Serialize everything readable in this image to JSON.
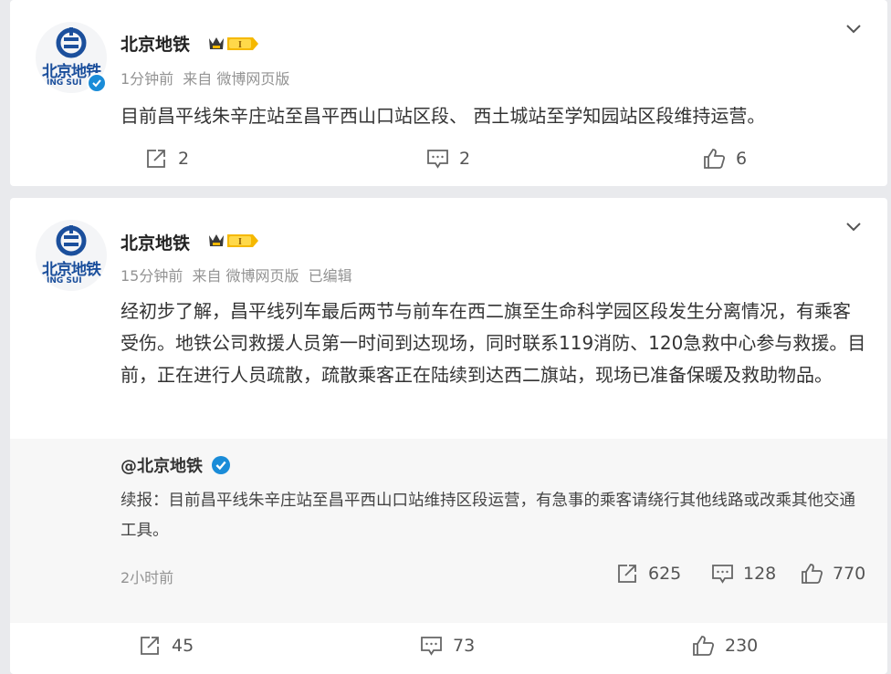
{
  "posts": [
    {
      "user": "北京地铁",
      "avatar_text": "北京地铁",
      "avatar_sub": "ING SUI",
      "time": "1分钟前",
      "source": "来自 微博网页版",
      "edited": "",
      "text": "目前昌平线朱辛庄站至昌平西山口站区段、 西土城站至学知园站区段维持运营。",
      "reposts": "2",
      "comments": "2",
      "likes": "6"
    },
    {
      "user": "北京地铁",
      "avatar_text": "北京地铁",
      "avatar_sub": "ING SUI",
      "time": "15分钟前",
      "source": "来自 微博网页版",
      "edited": "已编辑",
      "text": "经初步了解，昌平线列车最后两节与前车在西二旗至生命科学园区段发生分离情况，有乘客受伤。地铁公司救援人员第一时间到达现场，同时联系119消防、120急救中心参与救援。目前，正在进行人员疏散，疏散乘客正在陆续到达西二旗站，现场已准备保暖及救助物品。",
      "retweet": {
        "user": "@北京地铁",
        "text": "续报：目前昌平线朱辛庄站至昌平西山口站维持区段运营，有急事的乘客请绕行其他线路或改乘其他交通工具。",
        "time": "2小时前",
        "reposts": "625",
        "comments": "128",
        "likes": "770"
      },
      "reposts": "45",
      "comments": "73",
      "likes": "230"
    }
  ],
  "colors": {
    "brand_blue": "#1b4f9c",
    "verified_blue": "#1a8cd8",
    "badge_gold": "#f5b800"
  },
  "icons": [
    "repost-icon",
    "comment-icon",
    "like-icon",
    "chevron-down-icon",
    "verified-icon",
    "rank-badge-icon"
  ]
}
